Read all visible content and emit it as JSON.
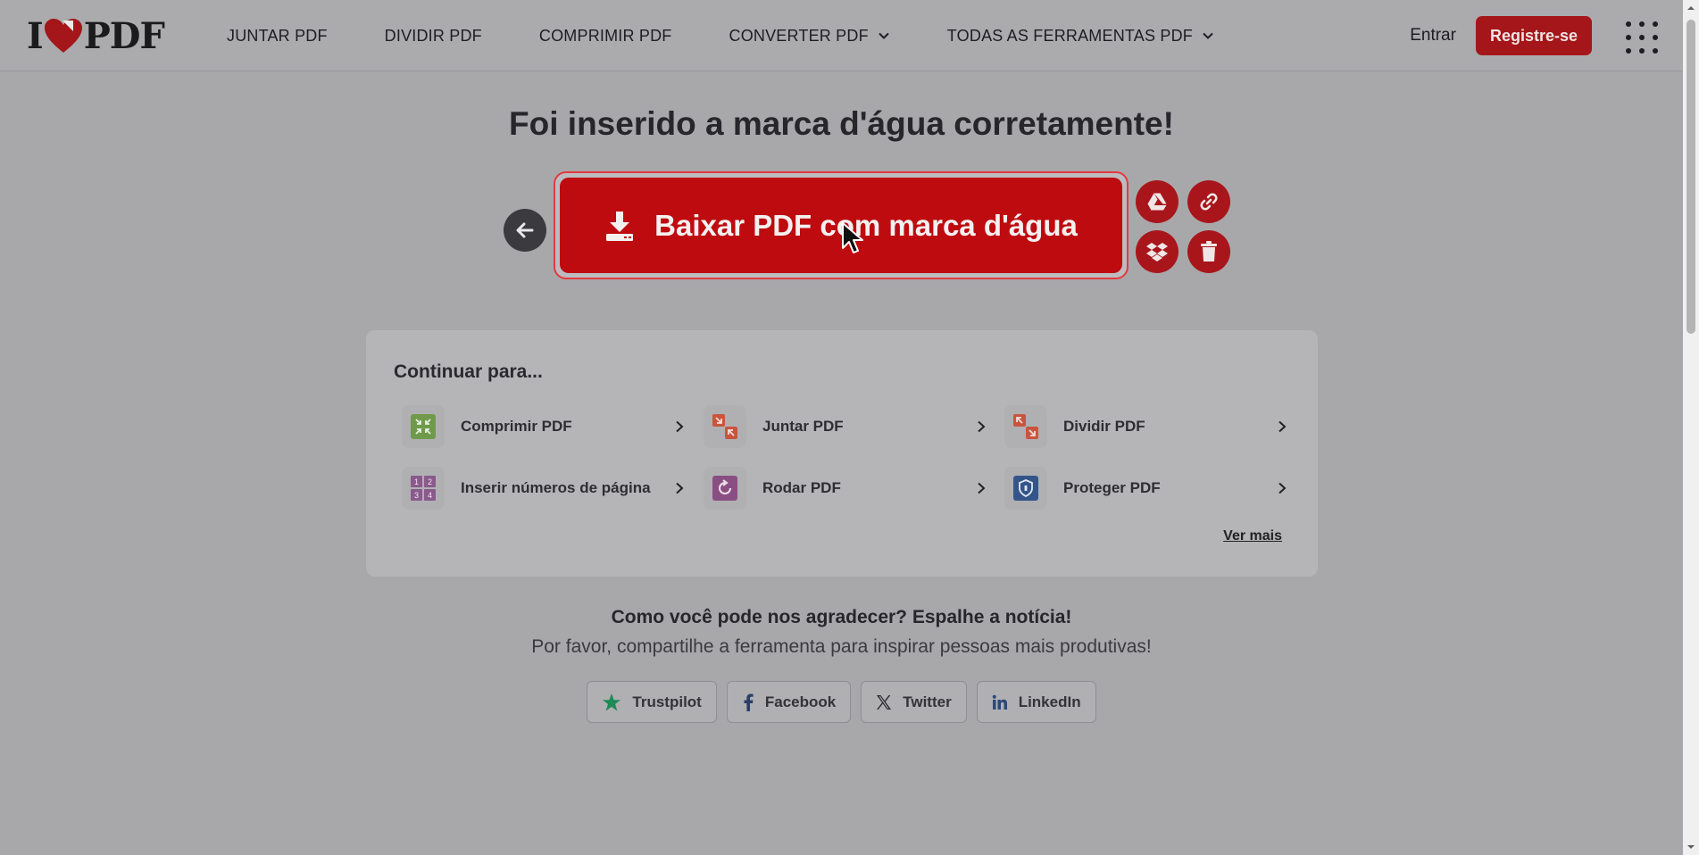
{
  "header": {
    "logo_left": "I",
    "logo_right": "PDF",
    "nav": [
      {
        "label": "JUNTAR PDF",
        "has_dropdown": false
      },
      {
        "label": "DIVIDIR PDF",
        "has_dropdown": false
      },
      {
        "label": "COMPRIMIR PDF",
        "has_dropdown": false
      },
      {
        "label": "CONVERTER PDF",
        "has_dropdown": true
      },
      {
        "label": "TODAS AS FERRAMENTAS PDF",
        "has_dropdown": true
      }
    ],
    "signin_label": "Entrar",
    "register_label": "Registre-se",
    "apps_icon": "grid-dots-icon"
  },
  "main": {
    "title": "Foi inserido a marca d'água corretamente!",
    "download_label": "Baixar PDF com marca d'água",
    "actions": [
      {
        "name": "google-drive",
        "icon": "google-drive-icon"
      },
      {
        "name": "share-link",
        "icon": "link-icon"
      },
      {
        "name": "dropbox",
        "icon": "dropbox-icon"
      },
      {
        "name": "delete",
        "icon": "trash-icon"
      }
    ]
  },
  "continue": {
    "title": "Continuar para...",
    "tools": [
      {
        "label": "Comprimir PDF",
        "icon": "compress-icon",
        "color": "#6f9a4c"
      },
      {
        "label": "Juntar PDF",
        "icon": "merge-icon",
        "color": "#c8553d"
      },
      {
        "label": "Dividir PDF",
        "icon": "split-icon",
        "color": "#c8553d"
      },
      {
        "label": "Inserir números de página",
        "icon": "page-numbers-icon",
        "color": "#8a5a8c"
      },
      {
        "label": "Rodar PDF",
        "icon": "rotate-icon",
        "color": "#8a4f82"
      },
      {
        "label": "Proteger PDF",
        "icon": "shield-icon",
        "color": "#34558a"
      }
    ],
    "see_more": "Ver mais"
  },
  "share": {
    "title": "Como você pode nos agradecer? Espalhe a notícia!",
    "subtitle": "Por favor, compartilhe a ferramenta para inspirar pessoas mais produtivas!",
    "buttons": [
      {
        "label": "Trustpilot",
        "icon": "trustpilot-star-icon"
      },
      {
        "label": "Facebook",
        "icon": "facebook-icon"
      },
      {
        "label": "Twitter",
        "icon": "x-twitter-icon"
      },
      {
        "label": "LinkedIn",
        "icon": "linkedin-icon"
      }
    ]
  },
  "colors": {
    "brand_red": "#be0b0f",
    "overlay_bg": "#a8a8ab"
  }
}
